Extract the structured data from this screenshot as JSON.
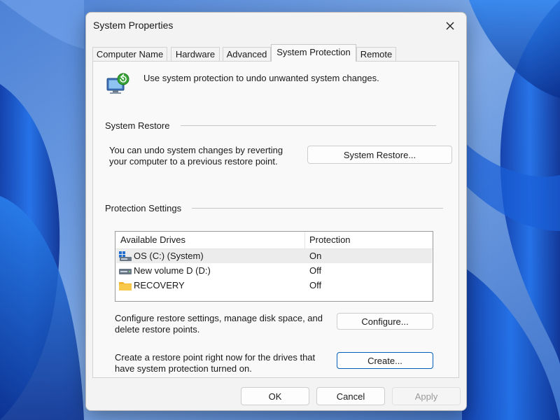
{
  "window": {
    "title": "System Properties",
    "close_icon": "close-icon"
  },
  "tabs": [
    {
      "label": "Computer Name",
      "active": false
    },
    {
      "label": "Hardware",
      "active": false
    },
    {
      "label": "Advanced",
      "active": false
    },
    {
      "label": "System Protection",
      "active": true
    },
    {
      "label": "Remote",
      "active": false
    }
  ],
  "intro": {
    "icon": "system-protection-icon",
    "text": "Use system protection to undo unwanted system changes."
  },
  "system_restore": {
    "section_label": "System Restore",
    "description_line1": "You can undo system changes by reverting",
    "description_line2": "your computer to a previous restore point.",
    "button_label": "System Restore..."
  },
  "protection_settings": {
    "section_label": "Protection Settings",
    "columns": [
      "Available Drives",
      "Protection"
    ],
    "drives": [
      {
        "name": "OS (C:) (System)",
        "protection": "On",
        "icon": "system-drive-icon",
        "selected": true
      },
      {
        "name": "New volume D (D:)",
        "protection": "Off",
        "icon": "drive-icon",
        "selected": false
      },
      {
        "name": "RECOVERY",
        "protection": "Off",
        "icon": "folder-icon",
        "selected": false
      }
    ],
    "configure_text_line1": "Configure restore settings, manage disk space, and",
    "configure_text_line2": "delete restore points.",
    "configure_button": "Configure...",
    "create_text_line1": "Create a restore point right now for the drives that",
    "create_text_line2": "have system protection turned on.",
    "create_button": "Create..."
  },
  "footer": {
    "ok": "OK",
    "cancel": "Cancel",
    "apply": "Apply"
  },
  "colors": {
    "accent": "#005fb8",
    "dialog_bg": "#f3f3f3",
    "panel_bg": "#f9f9f9",
    "wallpaper_base": "#5b8fd8"
  }
}
